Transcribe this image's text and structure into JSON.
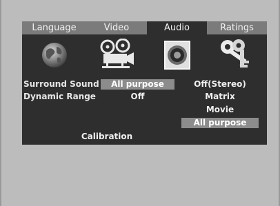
{
  "tabs": [
    {
      "label": "Language"
    },
    {
      "label": "Video"
    },
    {
      "label": "Audio"
    },
    {
      "label": "Ratings"
    }
  ],
  "icons": [
    "globe-icon",
    "projector-icon",
    "speaker-icon",
    "keys-icon"
  ],
  "settings": {
    "surround_sound_label": "Surround Sound",
    "surround_sound_value": "All purpose",
    "dynamic_range_label": "Dynamic Range",
    "dynamic_range_value": "Off",
    "calibration_label": "Calibration"
  },
  "dropdown": {
    "options": [
      "Off(Stereo)",
      "Matrix",
      "Movie",
      "All purpose"
    ],
    "selected": "All purpose"
  }
}
